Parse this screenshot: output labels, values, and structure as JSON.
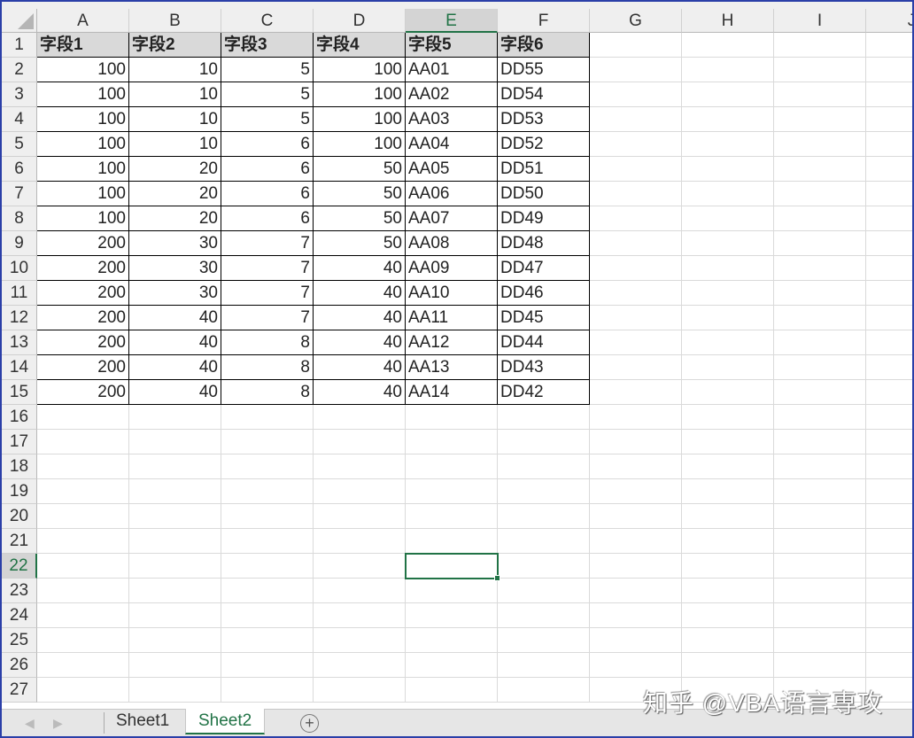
{
  "columns": [
    "A",
    "B",
    "C",
    "D",
    "E",
    "F",
    "G",
    "H",
    "I",
    "J"
  ],
  "selected_column": "E",
  "selected_row": 22,
  "row_count": 27,
  "table": {
    "headers": [
      "字段1",
      "字段2",
      "字段3",
      "字段4",
      "字段5",
      "字段6"
    ],
    "rows": [
      [
        100,
        10,
        5,
        100,
        "AA01",
        "DD55"
      ],
      [
        100,
        10,
        5,
        100,
        "AA02",
        "DD54"
      ],
      [
        100,
        10,
        5,
        100,
        "AA03",
        "DD53"
      ],
      [
        100,
        10,
        6,
        100,
        "AA04",
        "DD52"
      ],
      [
        100,
        20,
        6,
        50,
        "AA05",
        "DD51"
      ],
      [
        100,
        20,
        6,
        50,
        "AA06",
        "DD50"
      ],
      [
        100,
        20,
        6,
        50,
        "AA07",
        "DD49"
      ],
      [
        200,
        30,
        7,
        50,
        "AA08",
        "DD48"
      ],
      [
        200,
        30,
        7,
        40,
        "AA09",
        "DD47"
      ],
      [
        200,
        30,
        7,
        40,
        "AA10",
        "DD46"
      ],
      [
        200,
        40,
        7,
        40,
        "AA11",
        "DD45"
      ],
      [
        200,
        40,
        8,
        40,
        "AA12",
        "DD44"
      ],
      [
        200,
        40,
        8,
        40,
        "AA13",
        "DD43"
      ],
      [
        200,
        40,
        8,
        40,
        "AA14",
        "DD42"
      ]
    ]
  },
  "sheets": [
    {
      "label": "Sheet1",
      "active": false
    },
    {
      "label": "Sheet2",
      "active": true
    }
  ],
  "add_sheet_icon": "plus-circle-icon",
  "watermark": "知乎 @VBA语言専攻",
  "accent": "#217346"
}
